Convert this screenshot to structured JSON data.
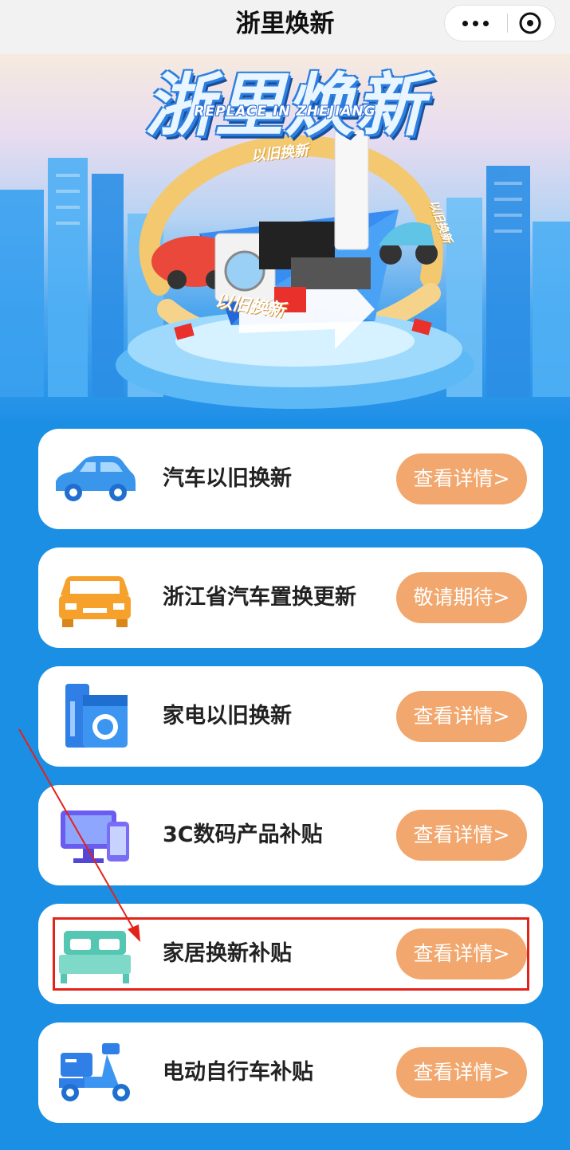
{
  "navbar": {
    "title": "浙里焕新",
    "more_icon": "more-dots-icon",
    "close_icon": "close-circle-icon"
  },
  "banner": {
    "title": "浙里焕新",
    "subtitle": "REPLACE IN ZHEJIANG",
    "arc_text_top": "以旧换新",
    "arc_text_bottom": "以旧换新",
    "arc_text_right": "以旧换新"
  },
  "cards": [
    {
      "label": "汽车以旧换新",
      "button": "查看详情>",
      "icon": "car-icon"
    },
    {
      "label": "浙江省汽车置换更新",
      "button": "敬请期待>",
      "icon": "car-front-icon"
    },
    {
      "label": "家电以旧换新",
      "button": "查看详情>",
      "icon": "appliance-icon"
    },
    {
      "label": "3C数码产品补贴",
      "button": "查看详情>",
      "icon": "devices-icon"
    },
    {
      "label": "家居换新补贴",
      "button": "查看详情>",
      "icon": "bed-icon"
    },
    {
      "label": "电动自行车补贴",
      "button": "查看详情>",
      "icon": "e-scooter-icon"
    }
  ],
  "colors": {
    "background": "#1b8fe4",
    "button": "#f1a76d",
    "highlight": "#e2231a"
  }
}
